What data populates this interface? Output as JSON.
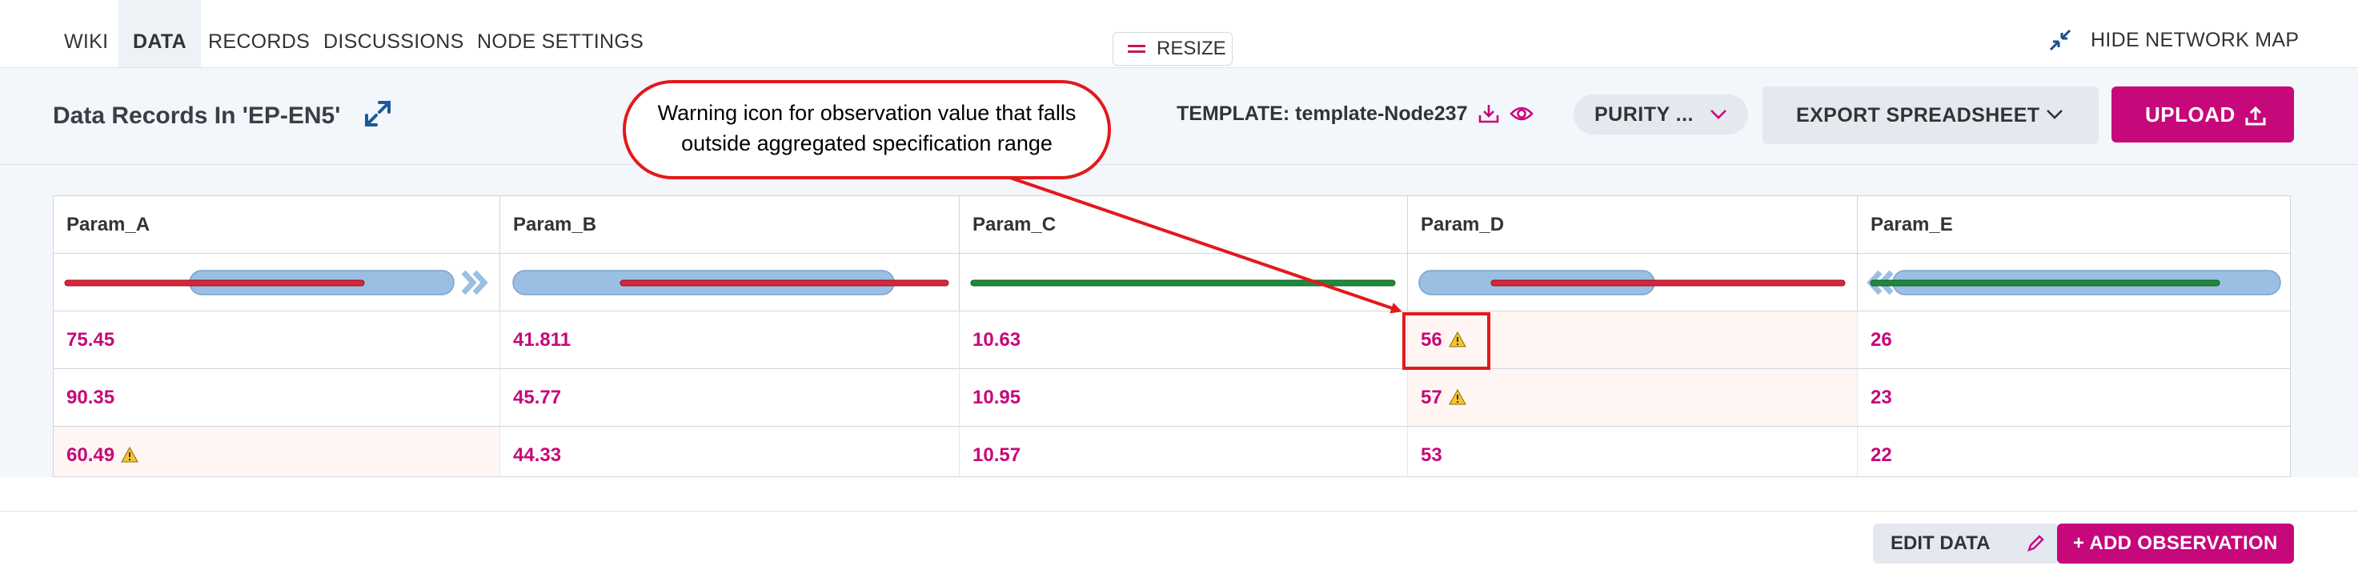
{
  "nav": {
    "tabs": [
      {
        "label": "WIKI"
      },
      {
        "label": "DATA"
      },
      {
        "label": "RECORDS"
      },
      {
        "label": "DISCUSSIONS"
      },
      {
        "label": "NODE SETTINGS"
      }
    ],
    "active_tab": "DATA",
    "resize_label": "RESIZE",
    "hide_map_label": "HIDE NETWORK MAP"
  },
  "header": {
    "title": "Data Records In 'EP-EN5'",
    "template_label": "TEMPLATE: template-Node237",
    "purity_label": "PURITY ...",
    "export_label": "EXPORT SPREADSHEET",
    "upload_label": "UPLOAD"
  },
  "table": {
    "columns": [
      "Param_A",
      "Param_B",
      "Param_C",
      "Param_D",
      "Param_E"
    ],
    "rows": [
      [
        {
          "value": "75.45",
          "warn": false
        },
        {
          "value": "41.811",
          "warn": false
        },
        {
          "value": "10.63",
          "warn": false
        },
        {
          "value": "56",
          "warn": true
        },
        {
          "value": "26",
          "warn": false
        }
      ],
      [
        {
          "value": "90.35",
          "warn": false
        },
        {
          "value": "45.77",
          "warn": false
        },
        {
          "value": "10.95",
          "warn": false
        },
        {
          "value": "57",
          "warn": true
        },
        {
          "value": "23",
          "warn": false
        }
      ],
      [
        {
          "value": "60.49",
          "warn": true
        },
        {
          "value": "44.33",
          "warn": false
        },
        {
          "value": "10.57",
          "warn": false
        },
        {
          "value": "53",
          "warn": false
        },
        {
          "value": "22",
          "warn": false
        }
      ]
    ]
  },
  "footer": {
    "edit_label": "EDIT DATA",
    "add_label": "+ ADD OBSERVATION"
  },
  "annotation": {
    "callout_line1": "Warning icon for observation value that falls",
    "callout_line2": "outside aggregated specification range"
  },
  "colors": {
    "brand": "#c6087a",
    "spec_range": "#9bbfe3",
    "out_of_spec": "#d9263a",
    "in_spec": "#1e8a3c",
    "annotation": "#e3191b"
  }
}
